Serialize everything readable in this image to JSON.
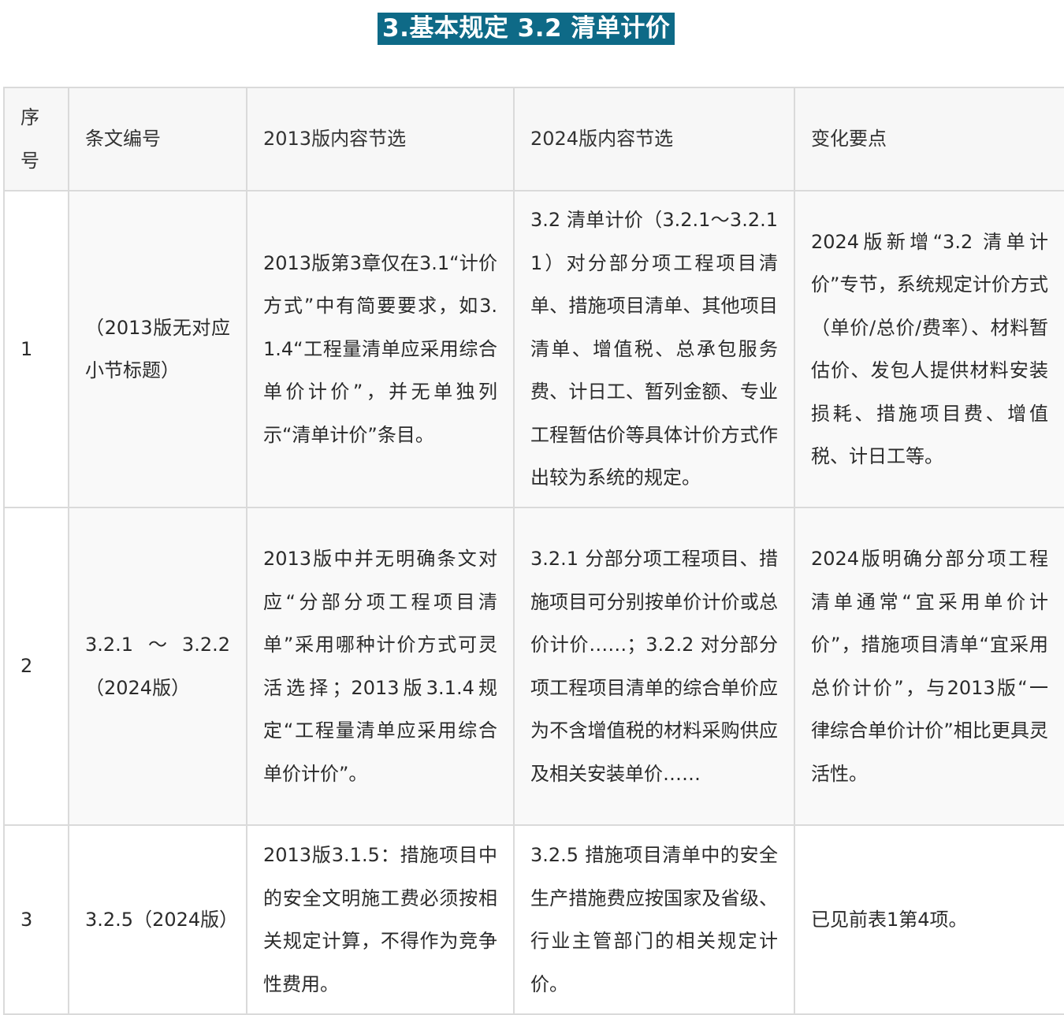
{
  "page": {
    "title": "3.基本规定  3.2 清单计价"
  },
  "table": {
    "headers": {
      "no": "序号",
      "clause": "条文编号",
      "v2013": "2013版内容节选",
      "v2024": "2024版内容节选",
      "changes": "变化要点"
    },
    "rows": [
      {
        "no": "1",
        "clause": "（2013版无对应小节标题）",
        "v2013": "2013版第3章仅在3.1“计价方式”中有简要要求，如3.1.4“工程量清单应采用综合单价计价”，并无单独列示“清单计价”条目。",
        "v2024": "3.2 清单计价（3.2.1～3.2.11）对分部分项工程项目清单、措施项目清单、其他项目清单、增值税、总承包服务费、计日工、暂列金额、专业工程暂估价等具体计价方式作出较为系统的规定。",
        "changes": "2024版新增“3.2 清单计价”专节，系统规定计价方式（单价/总价/费率）、材料暂估价、发包人提供材料安装损耗、措施项目费、增值税、计日工等。"
      },
      {
        "no": "2",
        "clause": "3.2.1～3.2.2（2024版）",
        "v2013": "2013版中并无明确条文对应“分部分项工程项目清单”采用哪种计价方式可灵活选择；2013版3.1.4规定“工程量清单应采用综合单价计价”。",
        "v2024": "3.2.1 分部分项工程项目、措施项目可分别按单价计价或总价计价……；3.2.2 对分部分项工程项目清单的综合单价应为不含增值税的材料采购供应及相关安装单价……",
        "changes": "2024版明确分部分项工程清单通常“宜采用单价计价”，措施项目清单“宜采用总价计价”，与2013版“一律综合单价计价”相比更具灵活性。"
      },
      {
        "no": "3",
        "clause": "3.2.5（2024版）",
        "v2013": "2013版3.1.5：措施项目中的安全文明施工费必须按相关规定计算，不得作为竞争性费用。",
        "v2024": "3.2.5 措施项目清单中的安全生产措施费应按国家及省级、行业主管部门的相关规定计价。",
        "changes": "已见前表1第4项。"
      }
    ]
  }
}
